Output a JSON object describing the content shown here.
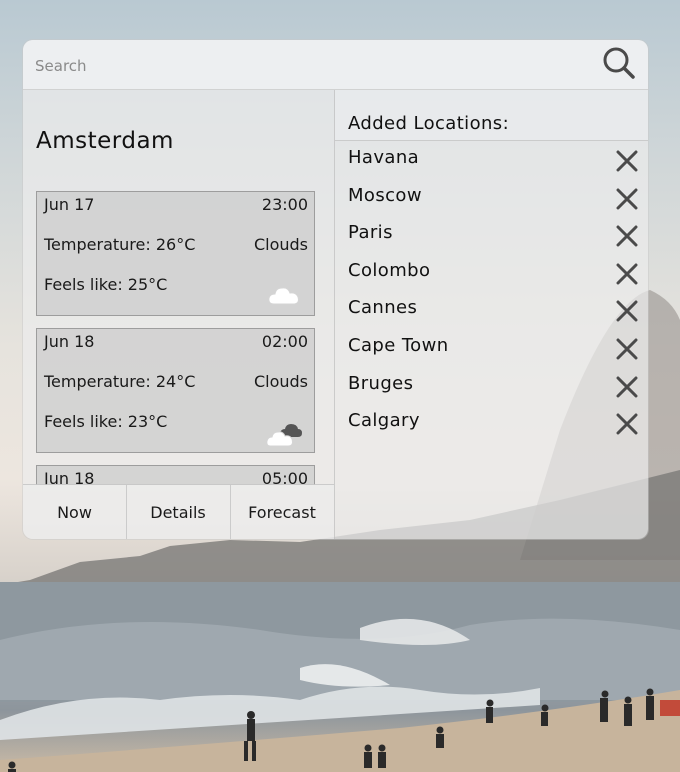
{
  "search": {
    "placeholder": "Search",
    "icon": "search-icon"
  },
  "current": {
    "city": "Amsterdam",
    "forecast": [
      {
        "date": "Jun 17",
        "time": "23:00",
        "temperature": "Temperature: 26°C",
        "condition": "Clouds",
        "feels_like": "Feels like: 25°C",
        "icon": "cloud-icon"
      },
      {
        "date": "Jun 18",
        "time": "02:00",
        "temperature": "Temperature: 24°C",
        "condition": "Clouds",
        "feels_like": "Feels like: 23°C",
        "icon": "broken-clouds-icon"
      },
      {
        "date": "Jun 18",
        "time": "05:00"
      }
    ]
  },
  "tabs": [
    {
      "label": "Now"
    },
    {
      "label": "Details"
    },
    {
      "label": "Forecast"
    }
  ],
  "locations": {
    "heading": "Added Locations:",
    "remove_icon": "close-icon",
    "items": [
      "Havana",
      "Moscow",
      "Paris",
      "Colombo",
      "Cannes",
      "Cape Town",
      "Bruges",
      "Calgary"
    ]
  },
  "colors": {
    "panel": "#ececec",
    "card": "#cdcdcd",
    "icon": "#4a4a4a"
  }
}
